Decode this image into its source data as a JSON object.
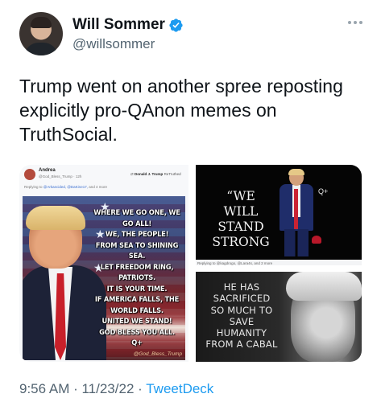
{
  "author": {
    "display_name": "Will Sommer",
    "handle": "@willsommer",
    "verified": true
  },
  "tweet": {
    "text": "Trump went on another spree reposting explicitly pro-QAnon memes on TruthSocial."
  },
  "media": {
    "left_post": {
      "poster_name": "Andrea",
      "poster_handle": "@God_Bless_Trump · 12h",
      "retruth_user": "Donald J. Trump",
      "retruth_suffix": "ReTruthed",
      "replying_prefix": "Replying to",
      "replying_mentions": "@Arkancided, @DaKine17,",
      "replying_suffix": "and 4 more",
      "meme_lines": [
        "WHERE WE GO ONE, WE GO ALL!",
        "WE, THE PEOPLE!",
        "FROM SEA TO SHINING SEA.",
        "LET FREEDOM RING, PATRIOTS.",
        "IT IS YOUR TIME.",
        "IF AMERICA FALLS, THE",
        "WORLD FALLS.",
        "UNITED WE STAND!",
        "GOD BLESS YOU ALL.",
        "Q+"
      ],
      "meme_credit": "@God_Bless_Trump"
    },
    "top_right": {
      "quote_lines": [
        "“WE",
        "WILL",
        "STAND",
        "STRONG"
      ],
      "q_mark": "Q+",
      "reply_text": "Replying to @kagdrogo, @Lara4s, and 2 more"
    },
    "bottom_right": {
      "text_lines": [
        "HE HAS",
        "SACRIFICED",
        "SO MUCH TO",
        "SAVE",
        "HUMANITY",
        "FROM A CABAL"
      ]
    }
  },
  "footer": {
    "time": "9:56 AM",
    "separator1": " · ",
    "date": "11/23/22",
    "separator2": " · ",
    "source": "TweetDeck"
  },
  "colors": {
    "accent": "#1d9bf0",
    "text": "#0f1419",
    "secondary": "#536471"
  },
  "icons": {
    "verified": "verified-badge-icon",
    "more": "more-options-icon"
  }
}
